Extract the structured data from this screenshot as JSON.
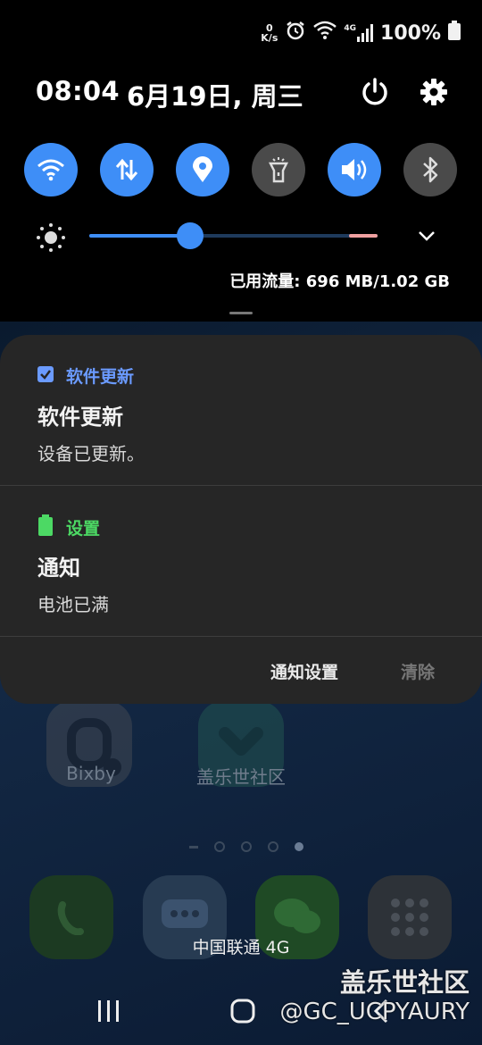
{
  "status_bar": {
    "net_speed_value": "0",
    "net_speed_unit": "K/s",
    "network_type": "4G",
    "battery": "100%"
  },
  "header": {
    "time": "08:04",
    "date": "6月19日, 周三"
  },
  "quick_toggles": [
    {
      "name": "wifi",
      "state": "on"
    },
    {
      "name": "mobile-data",
      "state": "on"
    },
    {
      "name": "location",
      "state": "on"
    },
    {
      "name": "flashlight",
      "state": "off"
    },
    {
      "name": "sound",
      "state": "on"
    },
    {
      "name": "bluetooth",
      "state": "off"
    }
  ],
  "brightness": {
    "level": 0.35
  },
  "data_usage": "已用流量: 696 MB/1.02 GB",
  "notifications": [
    {
      "app": "软件更新",
      "title": "软件更新",
      "text": "设备已更新。",
      "app_color": "#6b9bff"
    },
    {
      "app": "设置",
      "title": "通知",
      "text": "电池已满",
      "app_color": "#4cd964"
    }
  ],
  "panel_actions": {
    "settings": "通知设置",
    "clear": "清除"
  },
  "home": {
    "apps": [
      "Bixby",
      "盖乐世社区"
    ]
  },
  "carrier": "中国联通 4G",
  "watermark": {
    "line1": "盖乐世社区",
    "line2": "@GC_UCPYAURY"
  },
  "colors": {
    "accent": "#3e8ef7",
    "panel": "#262626"
  }
}
